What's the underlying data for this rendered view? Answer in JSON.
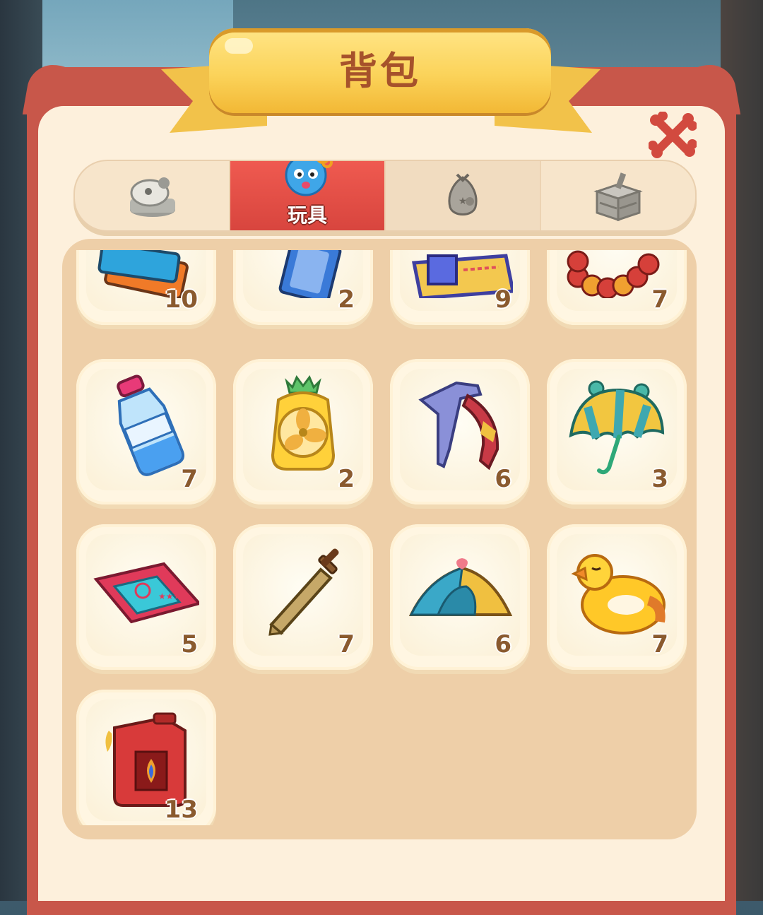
{
  "header": {
    "title": "背包"
  },
  "tabs": [
    {
      "icon": "sheep-icon",
      "label": ""
    },
    {
      "icon": "octopus-toy-icon",
      "label": "玩具"
    },
    {
      "icon": "bag-icon",
      "label": ""
    },
    {
      "icon": "crate-icon",
      "label": ""
    }
  ],
  "active_tab_index": 1,
  "items": [
    {
      "icon": "cards-icon",
      "count": "10"
    },
    {
      "icon": "book-icon",
      "count": "2"
    },
    {
      "icon": "map-icon",
      "count": "9"
    },
    {
      "icon": "bead-bracelet-icon",
      "count": "7"
    },
    {
      "icon": "water-bottle-icon",
      "count": "7"
    },
    {
      "icon": "pineapple-fan-icon",
      "count": "2"
    },
    {
      "icon": "ice-axe-icon",
      "count": "6"
    },
    {
      "icon": "umbrella-icon",
      "count": "3"
    },
    {
      "icon": "tickets-icon",
      "count": "5"
    },
    {
      "icon": "wooden-sword-icon",
      "count": "7"
    },
    {
      "icon": "tent-icon",
      "count": "6"
    },
    {
      "icon": "duck-float-icon",
      "count": "7"
    },
    {
      "icon": "fuel-can-icon",
      "count": "13"
    }
  ],
  "colors": {
    "accent_red": "#d8453e",
    "panel_cream": "#fdf0dc",
    "ribbon_yellow": "#fbd35a",
    "count_brown": "#8a5a2e"
  }
}
